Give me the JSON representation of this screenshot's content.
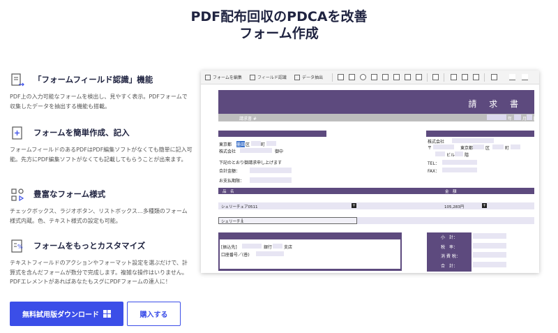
{
  "title": {
    "line1": "PDF配布回収のPDCAを改善",
    "line2": "フォーム作成"
  },
  "features": [
    {
      "icon": "form-recognition-icon",
      "title": "「フォームフィールド認識」機能",
      "desc": "PDF上の入力可能なフォームを検出し、見やすく表示。PDFフォームで収集したデータを抽出する機能も搭載。"
    },
    {
      "icon": "add-form-icon",
      "title": "フォームを簡単作成、記入",
      "desc": "フォームフィールドのあるPDFはPDF編集ソフトがなくても簡単に記入可能。先方にPDF編集ソフトがなくても記載してもらうことが出来ます。"
    },
    {
      "icon": "form-styles-icon",
      "title": "豊富なフォーム様式",
      "desc": "チェックボックス、ラジオボタン、リストボックス…多種類のフォーム様式内蔵。色、テキスト様式の設定も可能。"
    },
    {
      "icon": "customize-icon",
      "title": "フォームをもっとカスタマイズ",
      "desc": "テキストフィールドのアクションやフォーマット設定を選ぶだけで、計算式を含んだフォームが数分で完成します。複雑な操作はいりません。PDFエレメントがあればあなたもスグにPDFフォームの達人に！"
    }
  ],
  "buttons": {
    "download": "無料試用版ダウンロード",
    "buy": "購入する"
  },
  "screenshot": {
    "toolbar": {
      "edit_form": "フォームを編集",
      "field_recognition": "フィールド認識",
      "data_extract": "データ抽出"
    },
    "invoice_title": "請 求 書",
    "invoice_no": "請求書 #",
    "date_year": "年",
    "date_month": "月",
    "date_day": "日",
    "client_address": "東京都",
    "client_highlight": "墨田",
    "client_ku": "区",
    "client_cho": "町",
    "client_company": "株式会社",
    "client_onchu": "御中",
    "request_text": "下記のとおり御請求申し上げます",
    "total_label": "合計金額：",
    "due_label": "お支払期限：",
    "issuer_company": "株式会社",
    "issuer_postal": "〒",
    "issuer_address": "東京都",
    "issuer_ku": "区",
    "issuer_cho": "町",
    "issuer_building": "ビル",
    "issuer_floor": "階",
    "tel_label": "TEL：",
    "fax_label": "FAX：",
    "col_item": "品　名",
    "col_amount": "金　額",
    "item1_name": "シェリーチェア0511",
    "item1_amount": "105,283円",
    "item2_name": "シェリーチェ",
    "bank_transfer": "[振込先]",
    "bank_name": "銀行",
    "bank_branch": "支店",
    "bank_account": "口座番号／(普)",
    "subtotal": "小　計：",
    "tax_rate": "税　率：",
    "tax": "消 費 税：",
    "total": "合　計："
  },
  "colors": {
    "accent": "#3b4ee8",
    "invoice_purple": "#5d4a7e",
    "field_lavender": "#e7e5f3",
    "title_navy": "#1f2340"
  }
}
